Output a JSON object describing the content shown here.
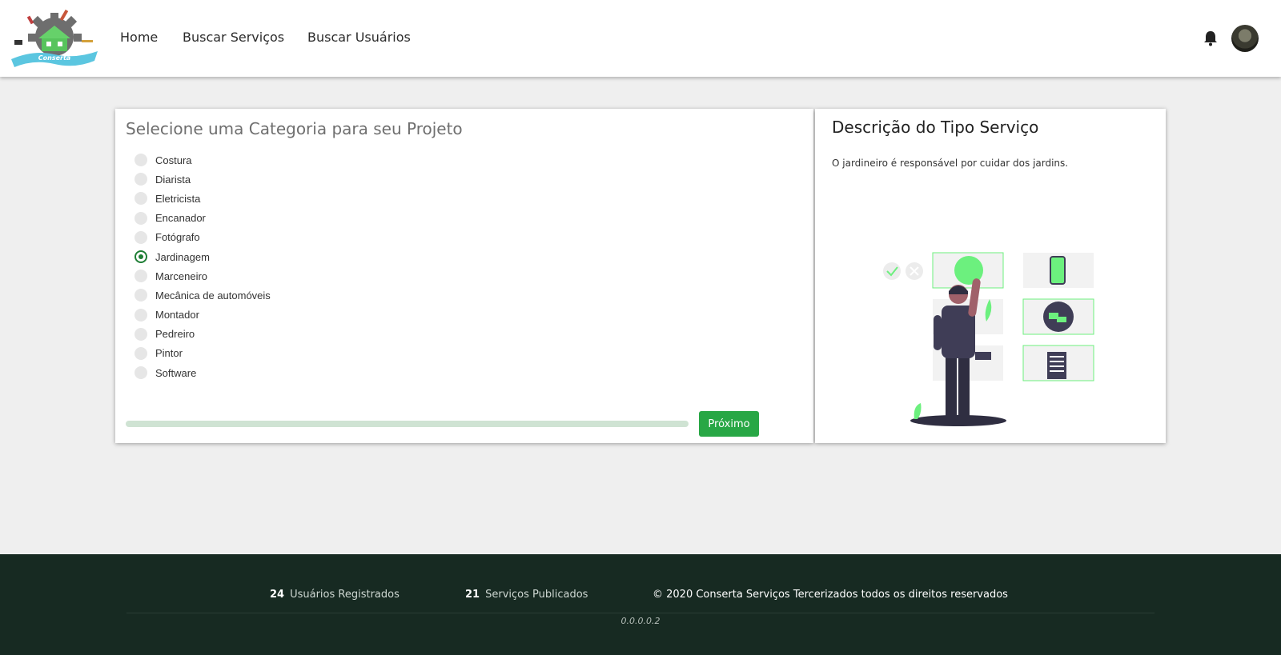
{
  "nav": {
    "logo_text": "Conserta",
    "links": [
      "Home",
      "Buscar Serviços",
      "Buscar Usuários"
    ],
    "bell_icon": "bell-icon",
    "avatar_icon": "user-avatar"
  },
  "category_form": {
    "title": "Selecione uma Categoria para seu Projeto",
    "options": [
      "Costura",
      "Diarista",
      "Eletricista",
      "Encanador",
      "Fotógrafo",
      "Jardinagem",
      "Marceneiro",
      "Mecânica de automóveis",
      "Montador",
      "Pedreiro",
      "Pintor",
      "Software"
    ],
    "selected": "Jardinagem",
    "progress": 0.0,
    "next_label": "Próximo"
  },
  "description": {
    "title": "Descrição do Tipo Serviço",
    "text": "O jardineiro é responsável por cuidar dos jardins."
  },
  "footer": {
    "users_count": "24",
    "users_label": "Usuários Registrados",
    "services_count": "21",
    "services_label": "Serviços Publicados",
    "copyright": "© 2020 Conserta Serviços Tercerizados todos os direitos reservados",
    "version": "0.0.0.0.2"
  },
  "colors": {
    "accent_green": "#28a745",
    "dark_green": "#1e7e34",
    "footer_bg": "#172a22",
    "progress_track": "#cfe3d3",
    "illustration_green": "#6cf07e"
  }
}
